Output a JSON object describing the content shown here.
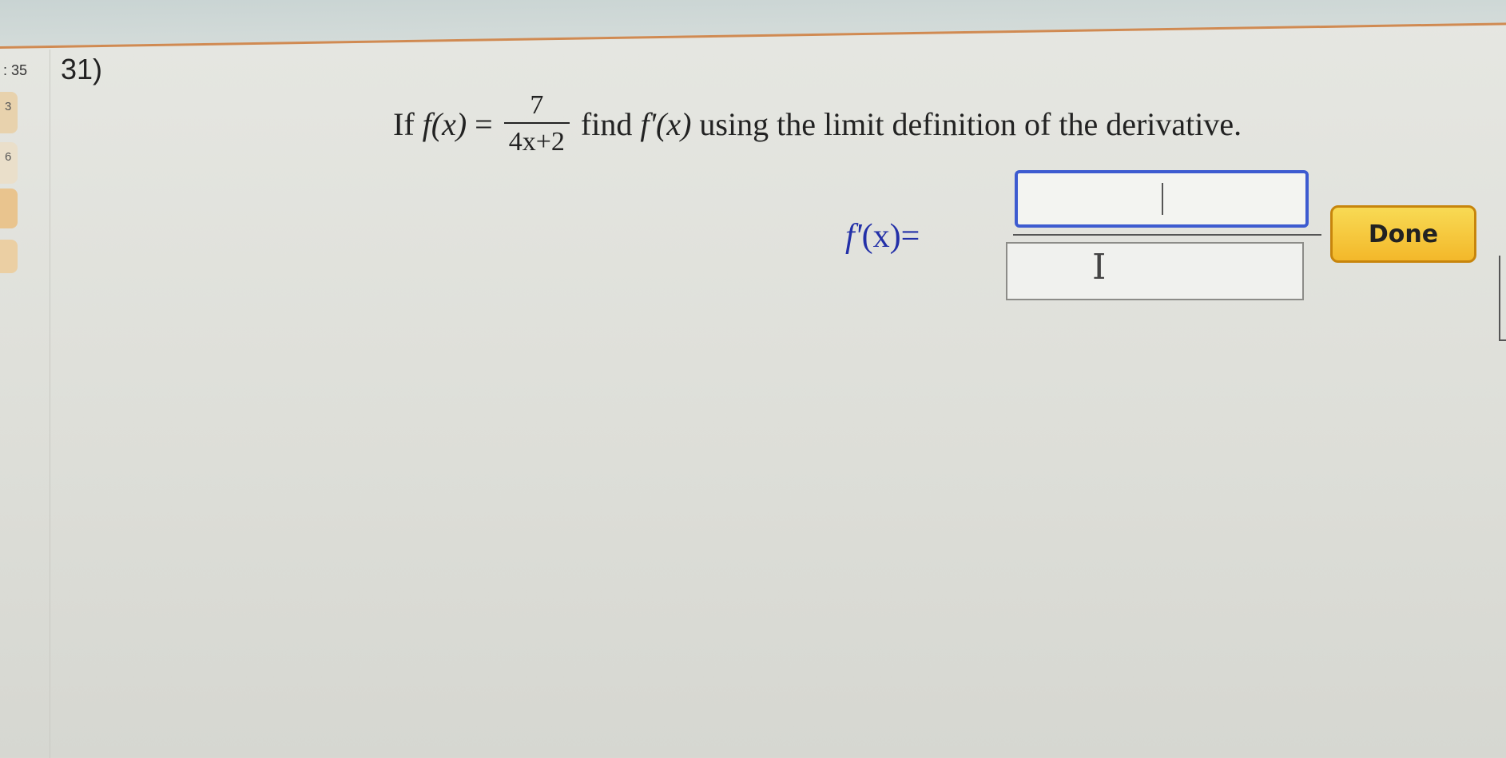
{
  "sidebar": {
    "question_index": ": 35",
    "items": [
      {
        "label": "3"
      },
      {
        "label": "6"
      },
      {
        "label": ""
      },
      {
        "label": ""
      }
    ]
  },
  "question": {
    "number": "31)",
    "prefix": "If",
    "function_name": "f(x)",
    "equals": "=",
    "fraction_numerator": "7",
    "fraction_denominator": "4x+2",
    "instruction_start": "find",
    "derivative_name": "f'(x)",
    "instruction_end": "using the limit definition of the derivative."
  },
  "answer": {
    "label_fn": "f'",
    "label_arg": "(x)",
    "label_eq": "=",
    "numerator_value": "",
    "denominator_value": ""
  },
  "done_button": {
    "label": "Done"
  },
  "colors": {
    "answer_text": "#2330a8",
    "active_box_border": "#3d5bd0",
    "done_button": "#f3b82a",
    "accent_top": "#d08a52"
  }
}
